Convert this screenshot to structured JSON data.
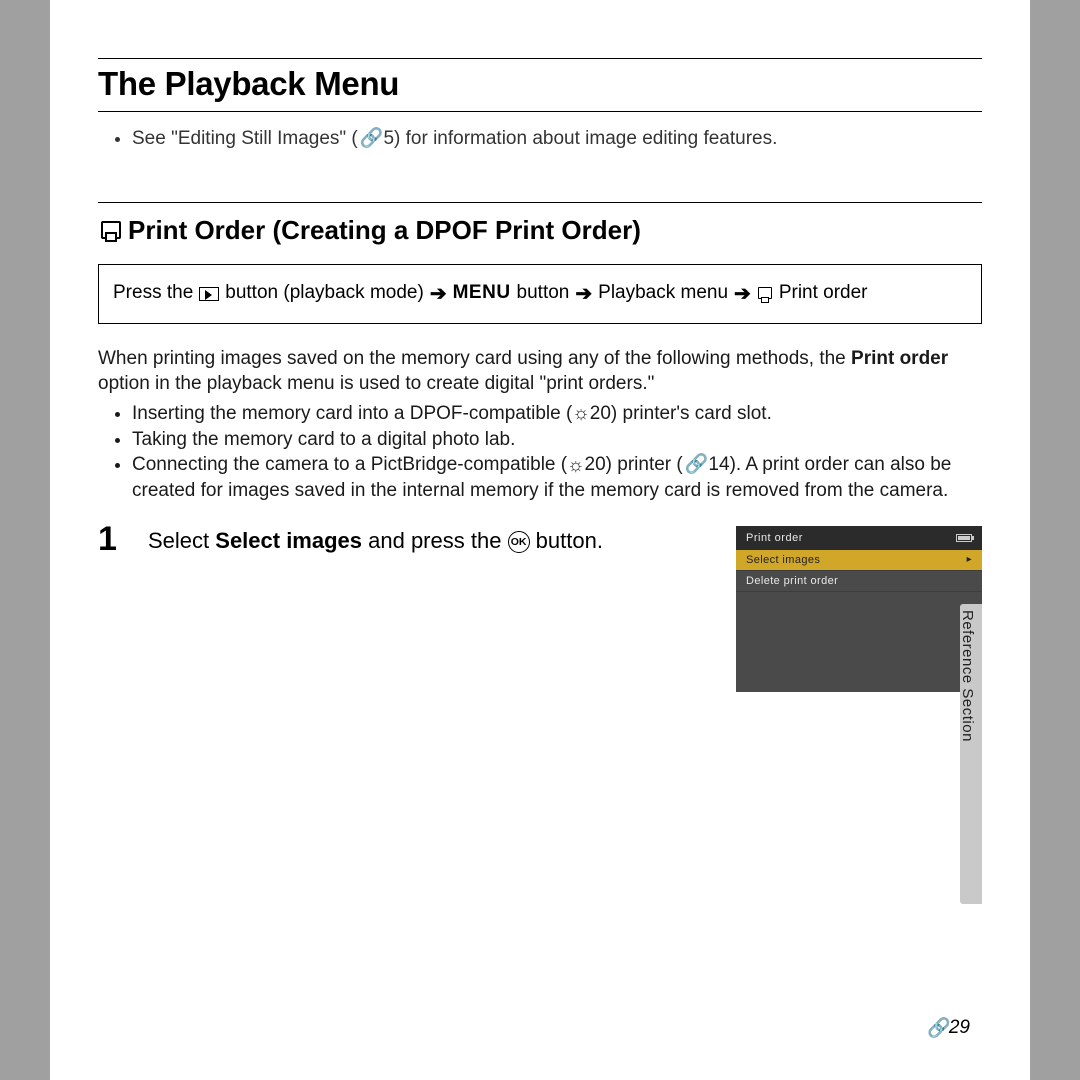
{
  "title": "The Playback Menu",
  "intro_bullet": {
    "prefix": "See \"Editing Still Images\" (",
    "ref": "5",
    "suffix": ") for information about image editing features."
  },
  "section_heading": "Print Order (Creating a DPOF Print Order)",
  "nav": {
    "press": "Press the ",
    "button_playback": " button (playback mode)",
    "menu": "MENU",
    "button_word": " button",
    "playback_menu": "Playback menu",
    "print_order": "Print order"
  },
  "para1": {
    "line1": "When printing images saved on the memory card using any of the following methods, the ",
    "bold": "Print order",
    "line2": " option in the playback menu is used to create digital \"print orders.\""
  },
  "bullets": {
    "b1_prefix": "Inserting the memory card into a DPOF-compatible (",
    "b1_ref": "20",
    "b1_suffix": ") printer's card slot.",
    "b2": "Taking the memory card to a digital photo lab.",
    "b3_prefix": "Connecting the camera to a PictBridge-compatible (",
    "b3_ref1": "20",
    "b3_mid": ") printer (",
    "b3_ref2": "14",
    "b3_suffix": "). A print order can also be created for images saved in the internal memory if the memory card is removed from the camera."
  },
  "step1": {
    "num": "1",
    "t1": "Select ",
    "bold": "Select images",
    "t2": " and press the ",
    "ok": "OK",
    "t3": " button."
  },
  "lcd": {
    "title": "Print order",
    "row1": "Select images",
    "row2": "Delete print order"
  },
  "side_label": "Reference Section",
  "page_num": "29"
}
